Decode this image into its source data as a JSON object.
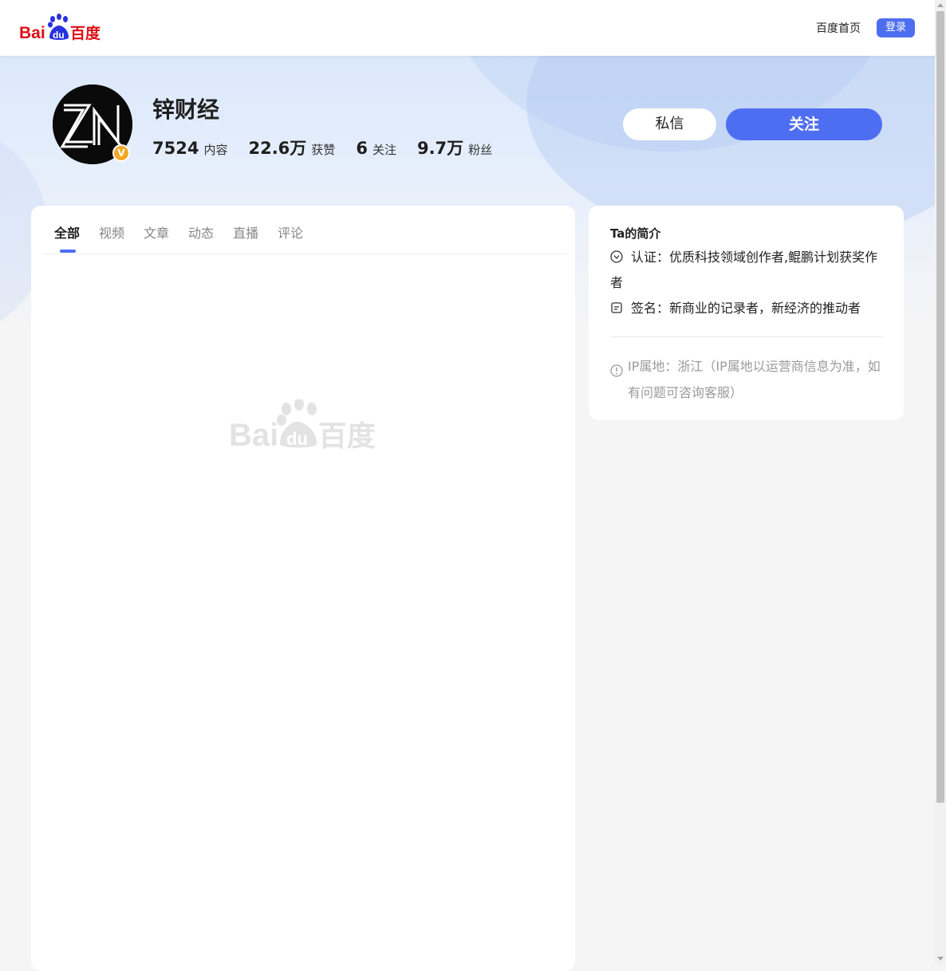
{
  "header": {
    "logo_alt": "Bai du 百度",
    "home_link": "百度首页",
    "login_label": "登录"
  },
  "profile": {
    "name": "锌财经",
    "avatar_text": "ZN",
    "verified_badge": "V",
    "stats": [
      {
        "num": "7524",
        "label": "内容"
      },
      {
        "num": "22.6万",
        "label": "获赞"
      },
      {
        "num": "6",
        "label": "关注"
      },
      {
        "num": "9.7万",
        "label": "粉丝"
      }
    ],
    "message_label": "私信",
    "follow_label": "关注"
  },
  "tabs": [
    {
      "label": "全部",
      "active": true
    },
    {
      "label": "视频",
      "active": false
    },
    {
      "label": "文章",
      "active": false
    },
    {
      "label": "动态",
      "active": false
    },
    {
      "label": "直播",
      "active": false
    },
    {
      "label": "评论",
      "active": false
    }
  ],
  "intro": {
    "title": "Ta的简介",
    "certification": "认证：优质科技领域创作者,鲲鹏计划获奖作者",
    "signature": "签名：新商业的记录者，新经济的推动者",
    "ip": "IP属地：浙江（IP属地以运营商信息为准，如有问题可咨询客服）"
  },
  "colors": {
    "accent": "#4e6ef2",
    "badge": "#f5a623",
    "baidu_red": "#de0f17",
    "baidu_blue": "#2932e1"
  },
  "icons": {
    "cert": "check-circle-icon",
    "signature": "note-icon",
    "ip": "info-circle-icon"
  }
}
